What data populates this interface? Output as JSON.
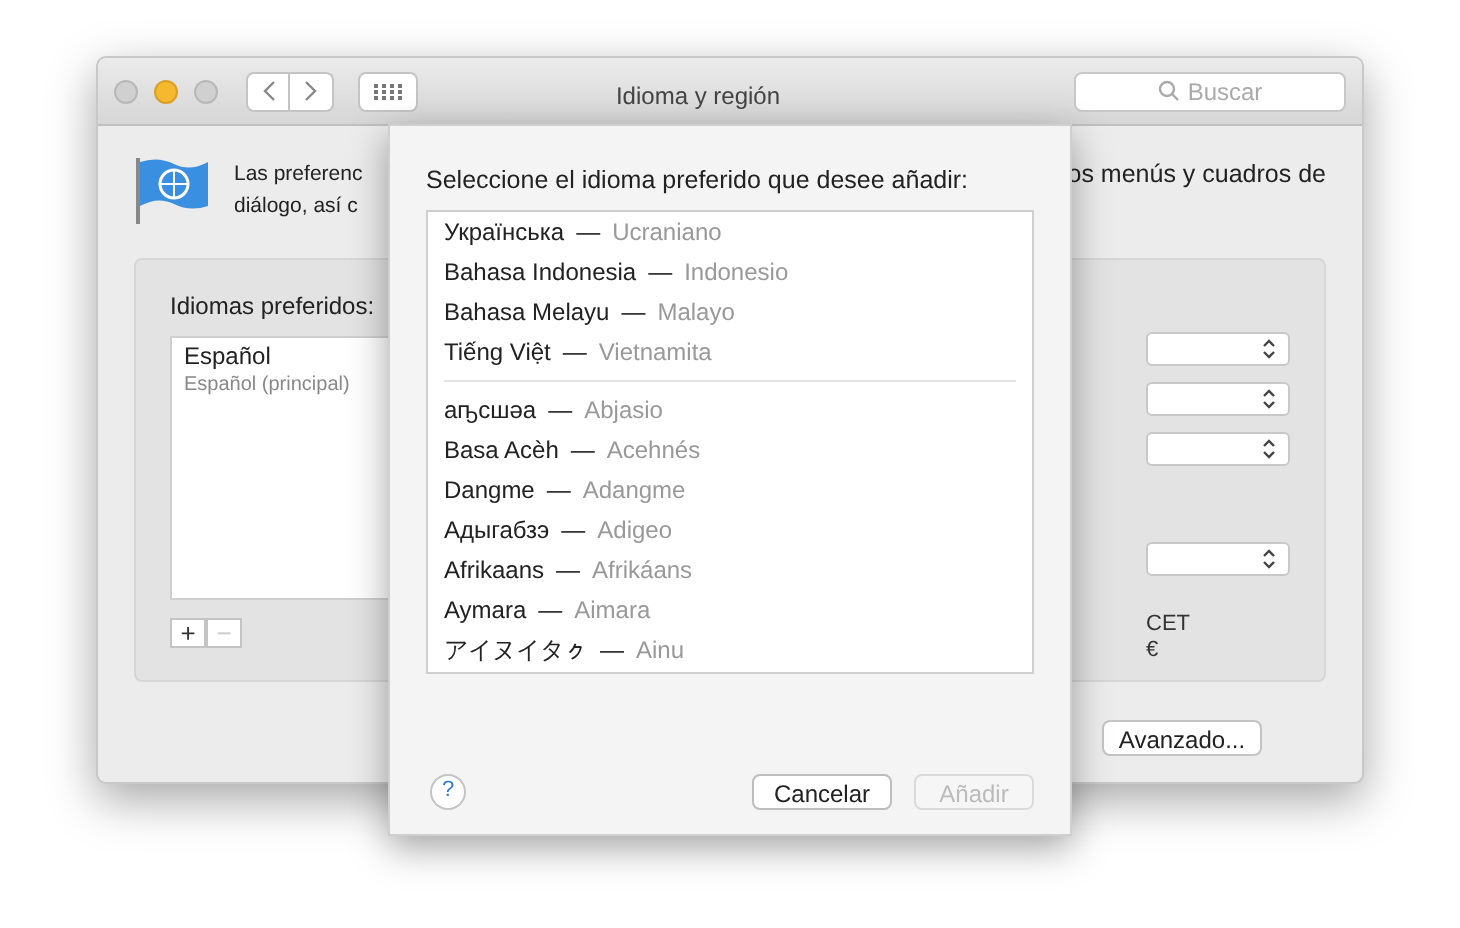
{
  "window": {
    "title": "Idioma y región",
    "search": {
      "placeholder": "Buscar"
    }
  },
  "intro": {
    "left_lines": [
      "Las preferenc",
      "diálogo, así c"
    ],
    "right_lines": [
      "os menús y cuadros de"
    ]
  },
  "preferred_languages": {
    "label": "Idiomas preferidos:",
    "items": [
      {
        "name": "Español",
        "subtitle": "Español (principal)",
        "selected": false
      }
    ],
    "buttons": [
      {
        "label": "+",
        "disabled": false
      },
      {
        "label": "−",
        "disabled": true
      }
    ]
  },
  "region_popups": [
    {
      "kind": "popup"
    },
    {
      "kind": "popup"
    },
    {
      "kind": "popup"
    },
    {
      "kind": "gap"
    },
    {
      "kind": "popup"
    }
  ],
  "region_texts": [
    "CET",
    "€"
  ],
  "advanced_button": "Avanzado...",
  "sheet": {
    "prompt": "Seleccione el idioma preferido que desee añadir:",
    "groups": [
      [
        {
          "native": "Українська",
          "translated": "Ucraniano"
        },
        {
          "native": "Bahasa Indonesia",
          "translated": "Indonesio"
        },
        {
          "native": "Bahasa Melayu",
          "translated": "Malayo"
        },
        {
          "native": "Tiếng Việt",
          "translated": "Vietnamita"
        }
      ],
      [
        {
          "native": "аҧсшәа",
          "translated": "Abjasio"
        },
        {
          "native": "Basa Acèh",
          "translated": "Acehnés"
        },
        {
          "native": "Dangme",
          "translated": "Adangme"
        },
        {
          "native": "Адыгабзэ",
          "translated": "Adigeo"
        },
        {
          "native": "Afrikaans",
          "translated": "Afrikáans"
        },
        {
          "native": "Aymara",
          "translated": "Aimara"
        },
        {
          "native": "アイヌイタㇰ",
          "translated": "Ainu"
        }
      ]
    ],
    "separator": "—",
    "help": "?",
    "buttons": [
      {
        "label": "Cancelar",
        "disabled": false
      },
      {
        "label": "Añadir",
        "disabled": true
      }
    ]
  }
}
